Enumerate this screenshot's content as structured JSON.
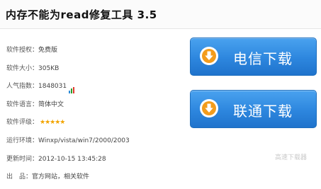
{
  "title": "内存不能为read修复工具 3.5",
  "info": [
    {
      "key": "软件授权：",
      "value": "免费版"
    },
    {
      "key": "软件大小：",
      "value": "305KB"
    },
    {
      "key": "人气指数：",
      "value": "1848031"
    },
    {
      "key": "软件语言：",
      "value": "简体中文"
    },
    {
      "key": "软件评级：",
      "value": "★★★★★",
      "rating": 5
    },
    {
      "key": "运行环境：",
      "value": "Winxp/vista/win7/2000/2003"
    },
    {
      "key": "更新时间：",
      "value": "2012-10-15 13:45:28"
    },
    {
      "key": "出　品：",
      "value": "官方网站，相关软件"
    }
  ],
  "buttons": {
    "dianxin": {
      "label": "电信下载",
      "icon": "download-arrow-icon"
    },
    "liantong": {
      "label": "联通下载",
      "icon": "download-arrow-icon"
    }
  },
  "watermark": "高速下载器",
  "colors": {
    "button_blue": "#2d86de",
    "star": "#f2a400"
  }
}
